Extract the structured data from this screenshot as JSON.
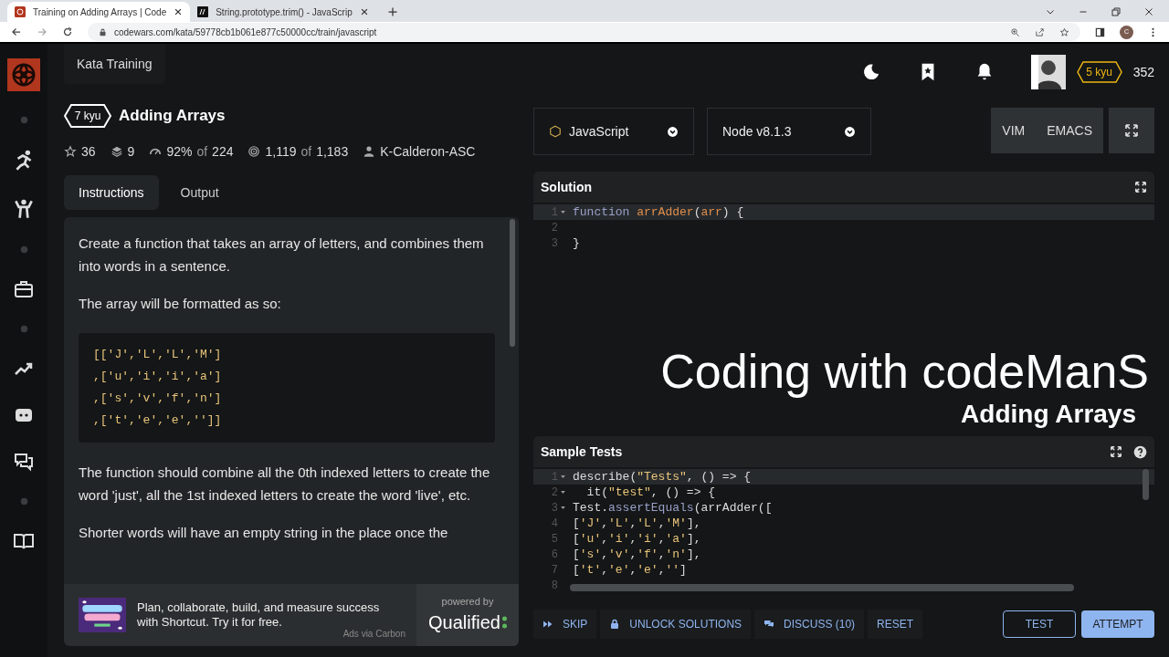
{
  "browser": {
    "tabs": [
      {
        "title": "Training on Adding Arrays | Code",
        "selected": true
      },
      {
        "title": "String.prototype.trim() - JavaScrip",
        "selected": false
      }
    ],
    "url": "codewars.com/kata/59778cb1b061e877c50000cc/train/javascript",
    "profile_initial": "C"
  },
  "header": {
    "section": "Kata Training",
    "rank": "5 kyu",
    "honor": "352"
  },
  "kata": {
    "rank": "7 kyu",
    "title": "Adding Arrays",
    "stats": [
      {
        "kind": "stars",
        "parts": [
          "36"
        ]
      },
      {
        "kind": "collections",
        "parts": [
          "9"
        ]
      },
      {
        "kind": "satisfaction",
        "parts": [
          "92%",
          "of",
          "224"
        ]
      },
      {
        "kind": "completed",
        "parts": [
          "1,119",
          "of",
          "1,183"
        ]
      },
      {
        "kind": "author",
        "parts": [
          "K-Calderon-ASC"
        ]
      }
    ]
  },
  "tabs": [
    {
      "label": "Instructions",
      "selected": true
    },
    {
      "label": "Output",
      "selected": false
    }
  ],
  "description": [
    {
      "kind": "text",
      "text": "Create a function that takes an array of letters, and combines them into words in a sentence."
    },
    {
      "kind": "text",
      "text": "The array will be formatted as so:"
    },
    {
      "kind": "code",
      "lines": [
        "[['J','L','L','M']",
        ",['u','i','i','a']",
        ",['s','v','f','n']",
        ",['t','e','e','']]"
      ]
    },
    {
      "kind": "text",
      "text": "The function should combine all the 0th indexed letters to create the word 'just', all the 1st indexed letters to create the word 'live', etc."
    },
    {
      "kind": "text",
      "text": "Shorter words will have an empty string in the place once the"
    }
  ],
  "ad": {
    "text": "Plan, collaborate, build, and measure success with Shortcut. Try it for free.",
    "source": "Ads via Carbon",
    "powered": "powered by",
    "brand": "Qualified"
  },
  "editor": {
    "language": "JavaScript",
    "version": "Node v8.1.3",
    "modes": [
      "VIM",
      "EMACS"
    ]
  },
  "solution": {
    "title": "Solution",
    "lines": [
      {
        "number": "1",
        "fold": true,
        "active": true,
        "tokens": [
          {
            "kind": "keyword",
            "t": "function "
          },
          {
            "kind": "name",
            "t": "arrAdder"
          },
          {
            "kind": "plain",
            "t": "("
          },
          {
            "kind": "name",
            "t": "arr"
          },
          {
            "kind": "plain",
            "t": ") {"
          }
        ]
      },
      {
        "number": "2",
        "fold": false,
        "active": false
      },
      {
        "number": "3",
        "fold": false,
        "active": false,
        "tokens": [
          {
            "kind": "plain",
            "t": "}"
          }
        ]
      }
    ]
  },
  "overlay": {
    "title": "Coding with codeManS",
    "subtitle": "Adding Arrays"
  },
  "tests": {
    "title": "Sample Tests",
    "lines": [
      {
        "number": "1",
        "fold": true,
        "active": true,
        "tokens": [
          {
            "kind": "plain",
            "t": "describe("
          },
          {
            "kind": "string",
            "t": "\"Tests\""
          },
          {
            "kind": "plain",
            "t": ", () => {"
          }
        ]
      },
      {
        "number": "2",
        "fold": true,
        "active": false,
        "tokens": [
          {
            "kind": "plain",
            "t": "  it("
          },
          {
            "kind": "string",
            "t": "\"test\""
          },
          {
            "kind": "plain",
            "t": ", () => {"
          }
        ]
      },
      {
        "number": "3",
        "fold": true,
        "active": false,
        "tokens": [
          {
            "kind": "plain",
            "t": "Test."
          },
          {
            "kind": "keyword",
            "t": "assertEquals"
          },
          {
            "kind": "plain",
            "t": "(arrAdder(["
          }
        ]
      },
      {
        "number": "4",
        "fold": false,
        "active": false,
        "tokens": [
          {
            "kind": "plain",
            "t": "["
          },
          {
            "kind": "string",
            "t": "'J'"
          },
          {
            "kind": "plain",
            "t": ","
          },
          {
            "kind": "string",
            "t": "'L'"
          },
          {
            "kind": "plain",
            "t": ","
          },
          {
            "kind": "string",
            "t": "'L'"
          },
          {
            "kind": "plain",
            "t": ","
          },
          {
            "kind": "string",
            "t": "'M'"
          },
          {
            "kind": "plain",
            "t": "],"
          }
        ]
      },
      {
        "number": "5",
        "fold": false,
        "active": false,
        "tokens": [
          {
            "kind": "plain",
            "t": "["
          },
          {
            "kind": "string",
            "t": "'u'"
          },
          {
            "kind": "plain",
            "t": ","
          },
          {
            "kind": "string",
            "t": "'i'"
          },
          {
            "kind": "plain",
            "t": ","
          },
          {
            "kind": "string",
            "t": "'i'"
          },
          {
            "kind": "plain",
            "t": ","
          },
          {
            "kind": "string",
            "t": "'a'"
          },
          {
            "kind": "plain",
            "t": "],"
          }
        ]
      },
      {
        "number": "6",
        "fold": false,
        "active": false,
        "tokens": [
          {
            "kind": "plain",
            "t": "["
          },
          {
            "kind": "string",
            "t": "'s'"
          },
          {
            "kind": "plain",
            "t": ","
          },
          {
            "kind": "string",
            "t": "'v'"
          },
          {
            "kind": "plain",
            "t": ","
          },
          {
            "kind": "string",
            "t": "'f'"
          },
          {
            "kind": "plain",
            "t": ","
          },
          {
            "kind": "string",
            "t": "'n'"
          },
          {
            "kind": "plain",
            "t": "],"
          }
        ]
      },
      {
        "number": "7",
        "fold": false,
        "active": false,
        "tokens": [
          {
            "kind": "plain",
            "t": "["
          },
          {
            "kind": "string",
            "t": "'t'"
          },
          {
            "kind": "plain",
            "t": ","
          },
          {
            "kind": "string",
            "t": "'e'"
          },
          {
            "kind": "plain",
            "t": ","
          },
          {
            "kind": "string",
            "t": "'e'"
          },
          {
            "kind": "plain",
            "t": ","
          },
          {
            "kind": "string",
            "t": "''"
          },
          {
            "kind": "plain",
            "t": "]"
          }
        ]
      },
      {
        "number": "8",
        "fold": false,
        "active": false
      }
    ]
  },
  "actions": [
    {
      "kind": "skip",
      "label": "SKIP"
    },
    {
      "kind": "unlock",
      "label": "UNLOCK SOLUTIONS"
    },
    {
      "kind": "discuss",
      "label": "DISCUSS (10)"
    },
    {
      "kind": "reset",
      "label": "RESET"
    },
    {
      "kind": "test",
      "label": "TEST"
    },
    {
      "kind": "attempt",
      "label": "ATTEMPT"
    }
  ]
}
